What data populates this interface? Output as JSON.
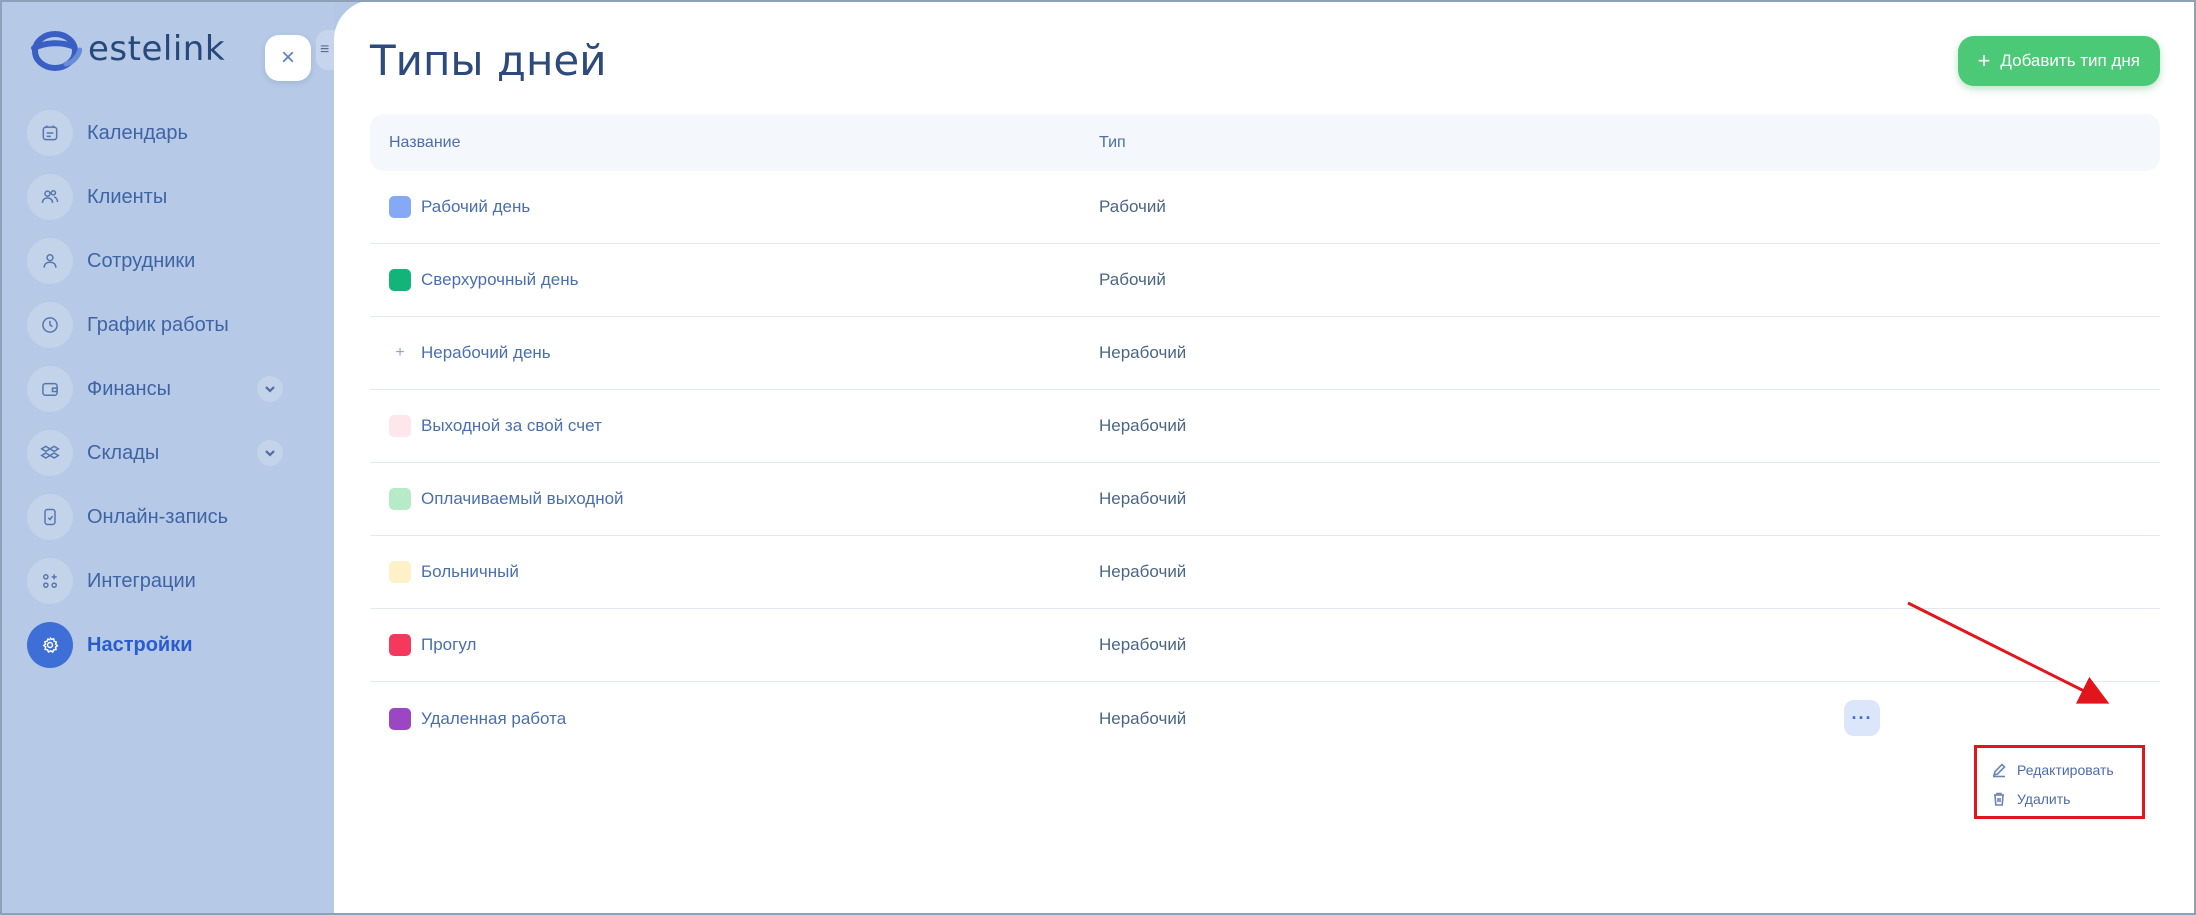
{
  "brand": {
    "name": "estelink"
  },
  "sidebar": {
    "close_icon": "close-icon",
    "items": [
      {
        "label": "Календарь",
        "icon": "calendar-icon",
        "active": false,
        "expandable": false
      },
      {
        "label": "Клиенты",
        "icon": "clients-icon",
        "active": false,
        "expandable": false
      },
      {
        "label": "Сотрудники",
        "icon": "user-icon",
        "active": false,
        "expandable": false
      },
      {
        "label": "График работы",
        "icon": "clock-icon",
        "active": false,
        "expandable": false
      },
      {
        "label": "Финансы",
        "icon": "wallet-icon",
        "active": false,
        "expandable": true
      },
      {
        "label": "Склады",
        "icon": "boxes-icon",
        "active": false,
        "expandable": true
      },
      {
        "label": "Онлайн-запись",
        "icon": "phone-icon",
        "active": false,
        "expandable": false
      },
      {
        "label": "Интеграции",
        "icon": "grid-plus-icon",
        "active": false,
        "expandable": false
      },
      {
        "label": "Настройки",
        "icon": "gear-icon",
        "active": true,
        "expandable": false
      }
    ]
  },
  "main": {
    "title": "Типы дней",
    "add_button_label": "Добавить тип дня",
    "table": {
      "headers": {
        "name": "Название",
        "type": "Тип"
      },
      "rows": [
        {
          "name": "Рабочий день",
          "type": "Рабочий",
          "color": "#86a9f5"
        },
        {
          "name": "Сверхурочный день",
          "type": "Рабочий",
          "color": "#12b47a"
        },
        {
          "name": "Нерабочий день",
          "type": "Нерабочий",
          "color": "none"
        },
        {
          "name": "Выходной за свой счет",
          "type": "Нерабочий",
          "color": "#fde7ec"
        },
        {
          "name": "Оплачиваемый выходной",
          "type": "Нерабочий",
          "color": "#b7ebc7"
        },
        {
          "name": "Больничный",
          "type": "Нерабочий",
          "color": "#fff1c7"
        },
        {
          "name": "Прогул",
          "type": "Нерабочий",
          "color": "#f5385d"
        },
        {
          "name": "Удаленная работа",
          "type": "Нерабочий",
          "color": "#9b46c2"
        }
      ]
    },
    "row_menu": {
      "button_label": "···",
      "items": [
        {
          "label": "Редактировать",
          "icon": "pencil-icon"
        },
        {
          "label": "Удалить",
          "icon": "trash-icon"
        }
      ]
    }
  },
  "colors": {
    "accent_green": "#4cc977",
    "accent_blue": "#3e6fd6",
    "annotation_red": "#e3151c"
  }
}
